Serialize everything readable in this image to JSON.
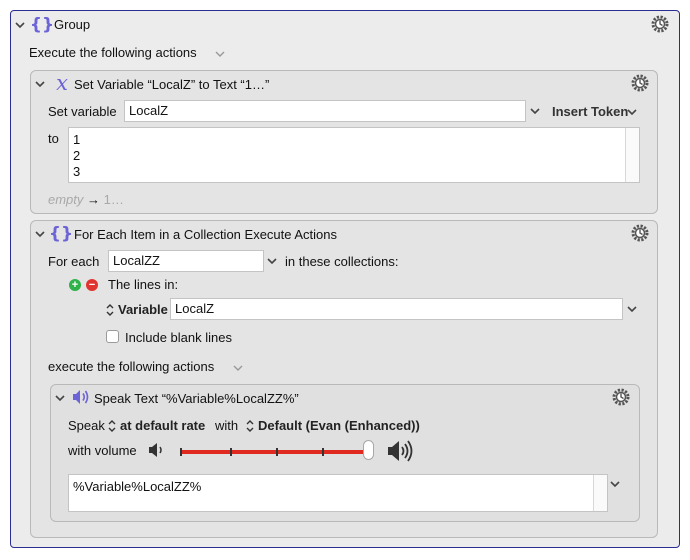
{
  "group": {
    "title": "Group",
    "execute_label": "Execute the following actions"
  },
  "set_variable": {
    "title": "Set Variable “LocalZ” to Text “1…”",
    "set_label": "Set variable",
    "variable_value": "LocalZ",
    "insert_token_label": "Insert Token",
    "to_label": "to",
    "text_lines": [
      "1",
      "2",
      "3"
    ],
    "footer_empty": "empty",
    "footer_arrow": "→",
    "footer_rest": "1…"
  },
  "for_each": {
    "title": "For Each Item in a Collection Execute Actions",
    "for_each_label": "For each",
    "variable_value": "LocalZZ",
    "in_collections_label": "in these collections:",
    "lines_in_label": "The lines in:",
    "variable_label": "Variable",
    "source_variable_value": "LocalZ",
    "include_blank_label": "Include blank lines",
    "include_blank_checked": false,
    "execute_label": "execute the following actions"
  },
  "speak_text": {
    "title": "Speak Text “%Variable%LocalZZ%”",
    "speak_label": "Speak",
    "rate_value": "at default rate",
    "with_label": "with",
    "voice_value": "Default (Evan (Enhanced))",
    "volume_label": "with volume",
    "volume_level": 1.0,
    "text_value": "%Variable%LocalZZ%"
  },
  "colors": {
    "frame_border": "#2b2e8f",
    "slider": "#e0291f",
    "icon_purple": "#6b63d6",
    "add_green": "#2fb24a",
    "remove_red": "#e0342e"
  }
}
